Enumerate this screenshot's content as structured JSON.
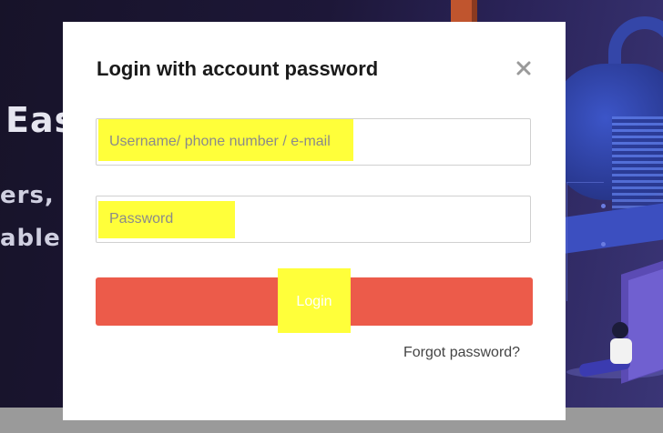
{
  "background": {
    "heading": "Eas",
    "line1": "ers,",
    "line2": "able"
  },
  "modal": {
    "title": "Login with account password",
    "close_icon": "close-icon"
  },
  "form": {
    "username_placeholder": "Username/ phone number / e-mail",
    "username_value": "",
    "password_placeholder": "Password",
    "password_value": "",
    "login_label": "Login",
    "forgot_label": "Forgot password?"
  },
  "colors": {
    "login_button": "#ec5b4a",
    "highlight": "#ffff3a"
  }
}
